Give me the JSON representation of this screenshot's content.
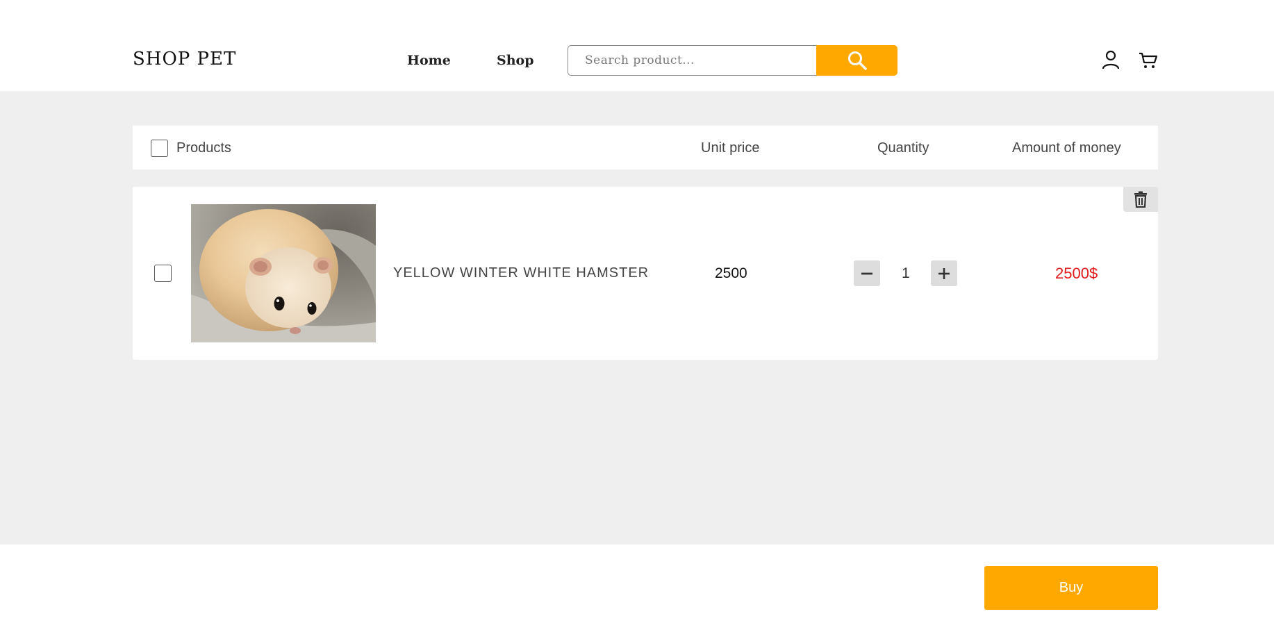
{
  "header": {
    "logo": "SHOP PET",
    "nav": {
      "home": "Home",
      "shop": "Shop"
    },
    "search": {
      "placeholder": "Search product...",
      "button_icon": "search-icon"
    },
    "icons": [
      "user-icon",
      "cart-icon"
    ]
  },
  "table": {
    "headers": {
      "products": "Products",
      "unit_price": "Unit price",
      "quantity": "Quantity",
      "amount": "Amount of money"
    }
  },
  "cart": {
    "items": [
      {
        "name": "YELLOW WINTER WHITE HAMSTER",
        "unit_price": "2500",
        "quantity": "1",
        "amount": "2500$"
      }
    ]
  },
  "footer": {
    "buy_label": "Buy"
  },
  "colors": {
    "accent": "#ffa800",
    "price_red": "#e21c1c",
    "background": "#efefef"
  }
}
